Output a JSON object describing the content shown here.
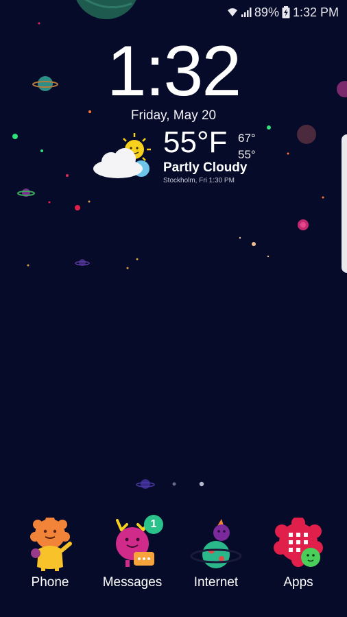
{
  "status_bar": {
    "battery_percent": "89%",
    "time": "1:32 PM",
    "icons": [
      "wifi-icon",
      "signal-icon",
      "battery-charging-icon"
    ]
  },
  "lock_clock": {
    "time": "1:32",
    "date": "Friday, May 20"
  },
  "weather": {
    "temperature": "55°F",
    "high": "67°",
    "low": "55°",
    "condition": "Partly Cloudy",
    "location_time": "Stockholm, Fri 1:30 PM",
    "icon": "partly-cloudy-sun-icon"
  },
  "pager": {
    "pages": 3,
    "current_index": 2
  },
  "dock": {
    "apps": [
      {
        "label": "Phone",
        "icon": "phone-monster-icon"
      },
      {
        "label": "Messages",
        "icon": "messages-monster-icon",
        "badge": "1"
      },
      {
        "label": "Internet",
        "icon": "internet-planet-icon"
      },
      {
        "label": "Apps",
        "icon": "apps-grid-monster-icon"
      }
    ]
  },
  "colors": {
    "background": "#060b2a",
    "badge": "#29c28b",
    "text": "#ffffff"
  }
}
